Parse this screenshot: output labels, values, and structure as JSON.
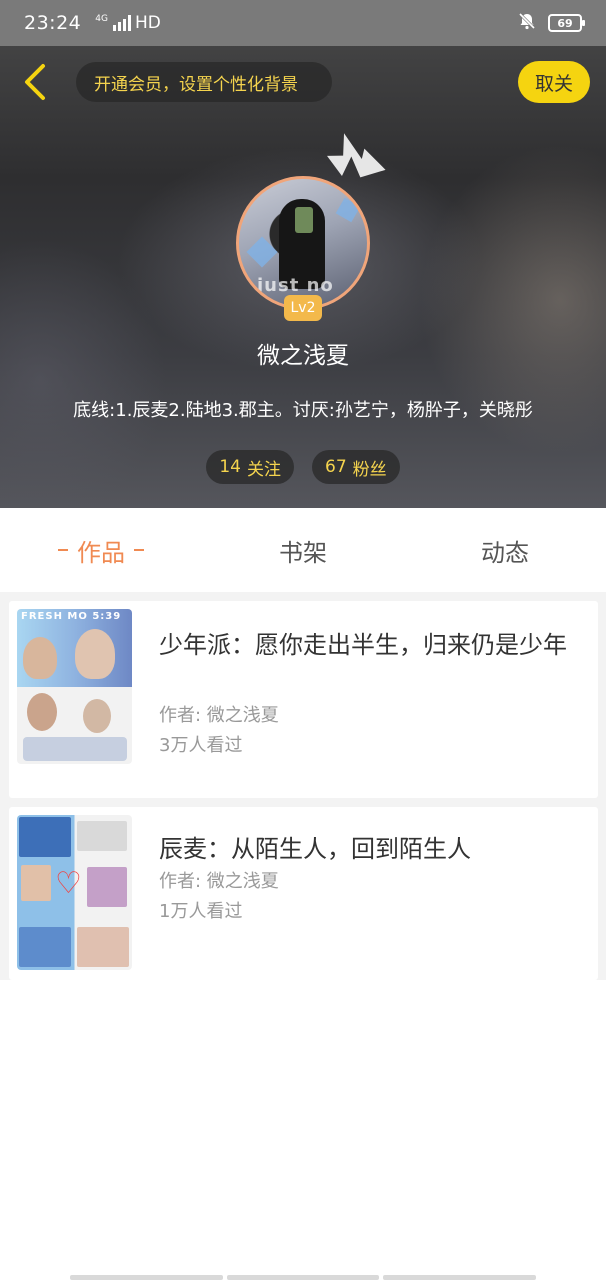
{
  "status_bar": {
    "time": "23:24",
    "network": "4G",
    "hd": "HD",
    "battery": "69"
  },
  "header": {
    "vip_prompt": "开通会员，设置个性化背景",
    "unfollow_label": "取关",
    "level": "Lv2",
    "avatar_text": "just no",
    "username": "微之浅夏",
    "bio": "底线:1.辰麦2.陆地3.郡主。讨厌:孙艺宁，杨肸子，关晓彤",
    "following_count": "14",
    "following_label": "关注",
    "fans_count": "67",
    "fans_label": "粉丝"
  },
  "tabs": [
    {
      "label": "作品",
      "active": true
    },
    {
      "label": "书架",
      "active": false
    },
    {
      "label": "动态",
      "active": false
    }
  ],
  "works": [
    {
      "title": "少年派：愿你走出半生，归来仍是少年",
      "author": "作者: 微之浅夏",
      "views": "3万人看过",
      "cover_text": "FRESH MO 5:39"
    },
    {
      "title": "辰麦：从陌生人，回到陌生人",
      "author": "作者: 微之浅夏",
      "views": "1万人看过"
    }
  ],
  "colors": {
    "accent": "#f08a52",
    "gold": "#f5d44e",
    "yellow_button": "#f5d410",
    "level_badge": "#f3b94b"
  },
  "icons": [
    "back-chevron-icon",
    "mute-bell-icon",
    "battery-icon",
    "signal-icon",
    "crown-icon"
  ]
}
